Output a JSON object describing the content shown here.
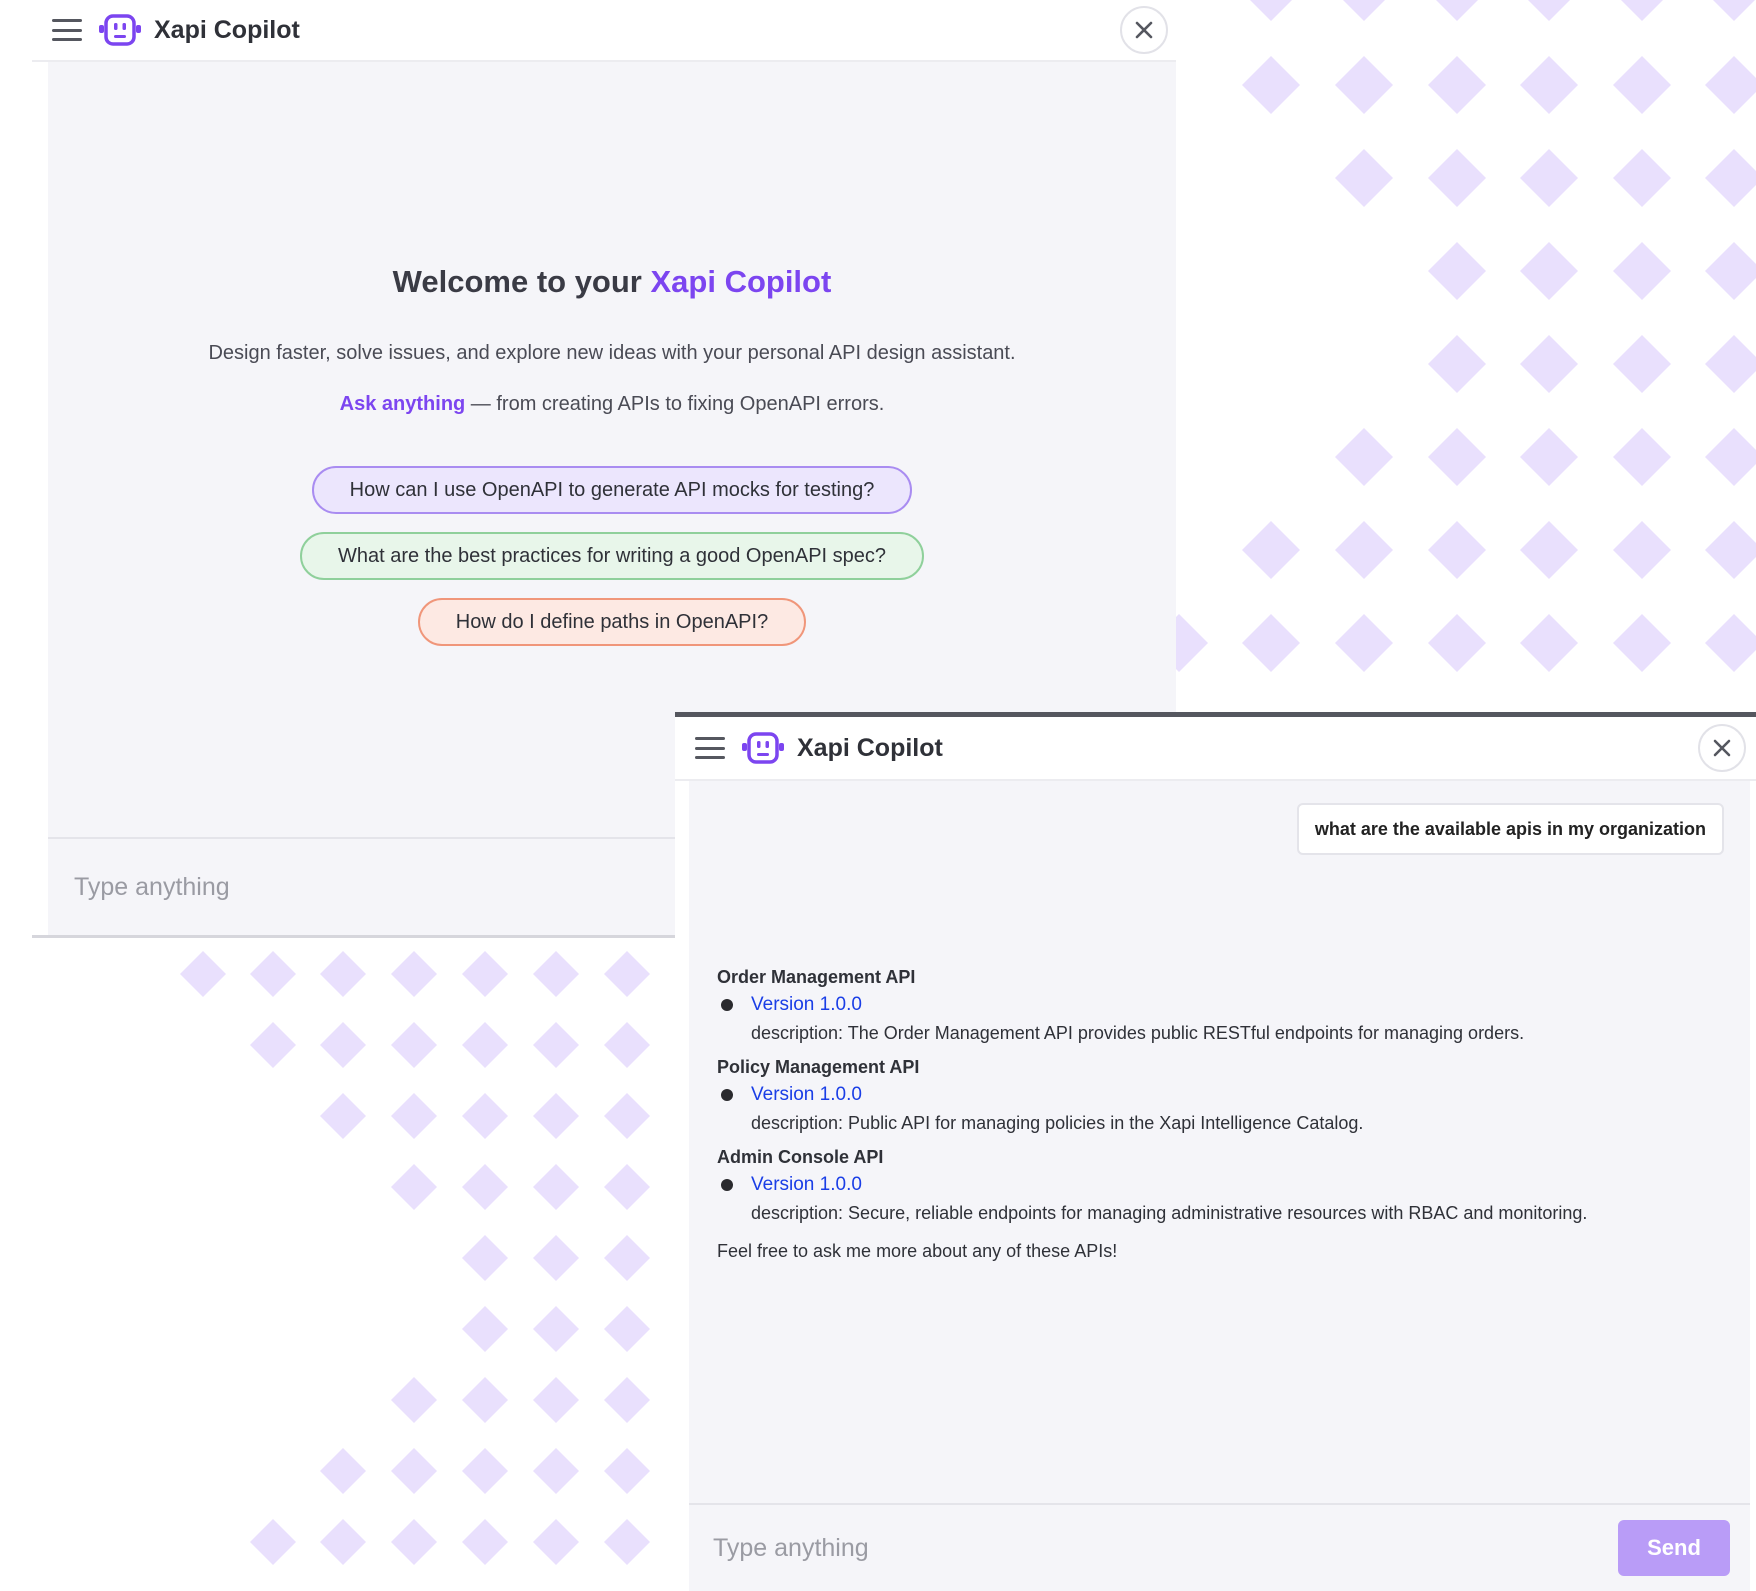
{
  "colors": {
    "accent": "#7c45f0",
    "pattern": "#e9e0fd",
    "link": "#1a3ee6",
    "send_button": "#b99cf7",
    "chip_purple": "#ece6fd",
    "chip_green": "#e8f6ea",
    "chip_orange": "#fde9e3"
  },
  "welcome_window": {
    "app_title": "Xapi Copilot",
    "menu_icon": "hamburger-menu-icon",
    "logo_icon": "robot-icon",
    "close_icon": "close-icon",
    "welcome_prefix": "Welcome to your ",
    "welcome_brand": "Xapi Copilot",
    "subtitle": "Design faster, solve issues, and explore new ideas with your personal API design assistant.",
    "ask_anything": "Ask anything",
    "ask_rest": " — from creating APIs to fixing OpenAPI errors.",
    "suggestions": [
      "How can I use OpenAPI to generate API mocks for testing?",
      "What are the best practices for writing a good OpenAPI spec?",
      "How do I define paths in OpenAPI?"
    ],
    "input_placeholder": "Type anything"
  },
  "chat_window": {
    "app_title": "Xapi Copilot",
    "menu_icon": "hamburger-menu-icon",
    "logo_icon": "robot-icon",
    "close_icon": "close-icon",
    "user_message": "what are the available apis in my organization",
    "apis": [
      {
        "name": "Order Management API",
        "version": "Version 1.0.0",
        "description": "description: The Order Management API provides public RESTful endpoints for managing orders."
      },
      {
        "name": "Policy Management API",
        "version": "Version 1.0.0",
        "description": "description: Public API for managing policies in the Xapi Intelligence Catalog."
      },
      {
        "name": "Admin Console API",
        "version": "Version 1.0.0",
        "description": "description: Secure, reliable endpoints for managing administrative resources with RBAC and monitoring."
      }
    ],
    "closing": "Feel free to ask me more about any of these APIs!",
    "input_placeholder": "Type anything",
    "send_label": "Send"
  }
}
